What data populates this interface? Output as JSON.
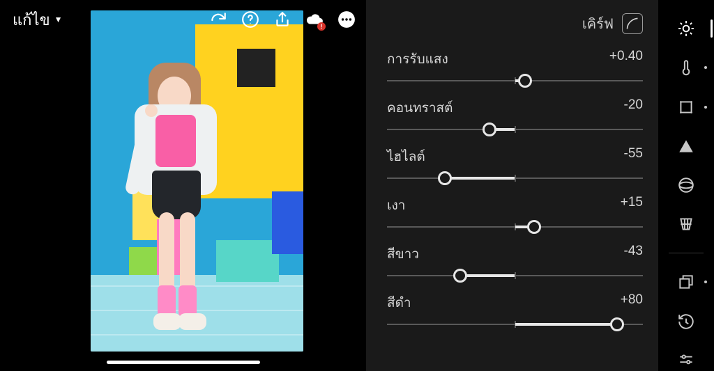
{
  "header": {
    "title": "แก้ไข"
  },
  "panel": {
    "title": "เคิร์ฟ"
  },
  "sliders": [
    {
      "label": "การรับแสง",
      "display": "+0.40",
      "min": -5,
      "max": 5,
      "value": 0.4
    },
    {
      "label": "คอนทราสต์",
      "display": "-20",
      "min": -100,
      "max": 100,
      "value": -20
    },
    {
      "label": "ไฮไลต์",
      "display": "-55",
      "min": -100,
      "max": 100,
      "value": -55
    },
    {
      "label": "เงา",
      "display": "+15",
      "min": -100,
      "max": 100,
      "value": 15
    },
    {
      "label": "สีขาว",
      "display": "-43",
      "min": -100,
      "max": 100,
      "value": -43
    },
    {
      "label": "สีดำ",
      "display": "+80",
      "min": -100,
      "max": 100,
      "value": 80
    }
  ],
  "tools": [
    {
      "name": "light",
      "active": true,
      "dot": false
    },
    {
      "name": "color",
      "active": false,
      "dot": true
    },
    {
      "name": "crop",
      "active": false,
      "dot": true
    },
    {
      "name": "effects",
      "active": false,
      "dot": false
    },
    {
      "name": "optics",
      "active": false,
      "dot": false
    },
    {
      "name": "geometry",
      "active": false,
      "dot": false
    }
  ]
}
